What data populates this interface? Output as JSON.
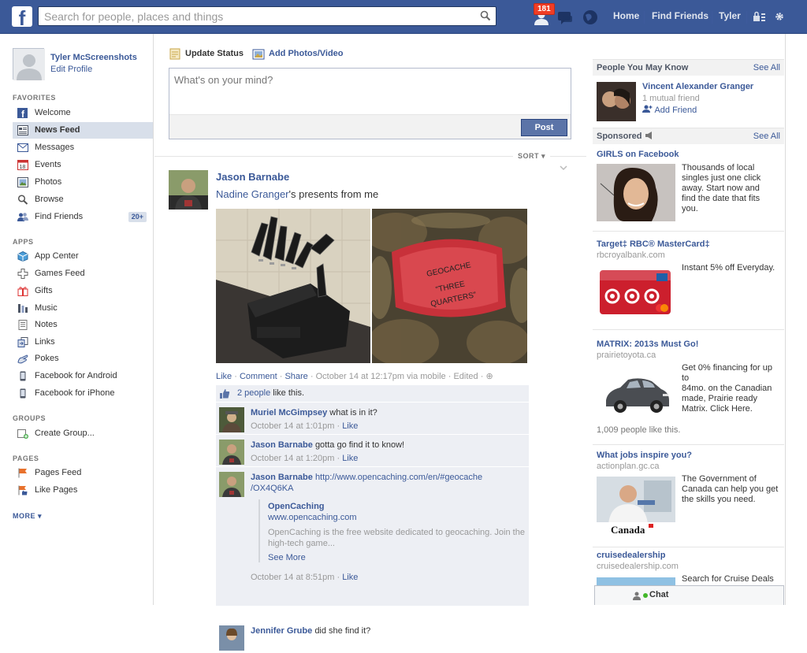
{
  "topbar": {
    "logo_letter": "f",
    "search_placeholder": "Search for people, places and things",
    "notification_count": "181",
    "nav": [
      "Home",
      "Find Friends",
      "Tyler"
    ]
  },
  "profile": {
    "name": "Tyler McScreenshots",
    "edit": "Edit Profile"
  },
  "sidebar": {
    "favorites_header": "FAVORITES",
    "favorites": [
      {
        "label": "Welcome",
        "icon": "facebook-icon"
      },
      {
        "label": "News Feed",
        "icon": "news-feed-icon",
        "selected": true
      },
      {
        "label": "Messages",
        "icon": "messages-icon"
      },
      {
        "label": "Events",
        "icon": "calendar-icon",
        "date": "18"
      },
      {
        "label": "Photos",
        "icon": "photos-icon"
      },
      {
        "label": "Browse",
        "icon": "search-icon"
      },
      {
        "label": "Find Friends",
        "icon": "friends-icon",
        "count": "20+"
      }
    ],
    "apps_header": "APPS",
    "apps": [
      {
        "label": "App Center",
        "icon": "app-center-icon"
      },
      {
        "label": "Games Feed",
        "icon": "games-icon"
      },
      {
        "label": "Gifts",
        "icon": "gift-icon"
      },
      {
        "label": "Music",
        "icon": "music-icon"
      },
      {
        "label": "Notes",
        "icon": "notes-icon"
      },
      {
        "label": "Links",
        "icon": "links-icon"
      },
      {
        "label": "Pokes",
        "icon": "poke-icon"
      },
      {
        "label": "Facebook for Android",
        "icon": "phone-icon"
      },
      {
        "label": "Facebook for iPhone",
        "icon": "phone-icon"
      }
    ],
    "groups_header": "GROUPS",
    "groups": [
      {
        "label": "Create Group...",
        "icon": "create-group-icon"
      }
    ],
    "pages_header": "PAGES",
    "pages": [
      {
        "label": "Pages Feed",
        "icon": "pages-feed-icon"
      },
      {
        "label": "Like Pages",
        "icon": "like-pages-icon"
      }
    ],
    "more": "MORE"
  },
  "composer": {
    "tab_status": "Update Status",
    "tab_photo": "Add Photos/Video",
    "placeholder": "What's on your mind?",
    "post": "Post"
  },
  "sort_label": "SORT",
  "story": {
    "author": "Jason Barnabe",
    "tagged": "Nadine Granger",
    "text_suffix": "'s presents from me",
    "photo1_label": "knife block",
    "photo2_text": "GEOCACHE \"THREE QUARTERS\"",
    "actions": [
      "Like",
      "Comment",
      "Share"
    ],
    "timestamp": "October 14 at 12:17pm via mobile",
    "edited": "Edited",
    "likes_count": "2 people",
    "likes_suffix": " like this.",
    "comments": [
      {
        "author": "Muriel McGimpsey",
        "text": "what is in it?",
        "time": "October 14 at 1:01pm",
        "like": "Like"
      },
      {
        "author": "Jason Barnabe",
        "text": "gotta go find it to know!",
        "time": "October 14 at 1:20pm",
        "like": "Like"
      },
      {
        "author": "Jason Barnabe",
        "link_line1": "http://www.opencaching.com/en/#geocache",
        "link_line2": "/OX4Q6KA",
        "preview_title": "OpenCaching",
        "preview_url": "www.opencaching.com",
        "preview_desc1": "OpenCaching is the free website dedicated to geocaching. Join the",
        "preview_desc2": "high-tech game...",
        "see_more": "See More",
        "time": "October 14 at 8:51pm",
        "like": "Like"
      },
      {
        "author": "Jennifer Grube",
        "text": "did she find it?"
      }
    ]
  },
  "right": {
    "pymk_header": "People You May Know",
    "see_all": "See All",
    "pymk": {
      "name": "Vincent Alexander Granger",
      "mutual": "1 mutual friend",
      "add": "Add Friend"
    },
    "sponsored_header": "Sponsored",
    "ads": [
      {
        "title": "GIRLS on Facebook",
        "url": "",
        "text": [
          "Thousands of local",
          "singles just one click",
          "away. Start now and",
          "find the date that fits",
          "you."
        ]
      },
      {
        "title": "Target‡ RBC® MasterCard‡",
        "url": "rbcroyalbank.com",
        "text": [
          "Instant 5% off Everyday."
        ]
      },
      {
        "title": "MATRIX: 2013s Must Go!",
        "url": "prairietoyota.ca",
        "text": [
          "Get 0% financing for up to",
          "84mo. on the Canadian",
          "made, Prairie ready",
          "Matrix. Click Here."
        ],
        "social": "1,009 people like this."
      },
      {
        "title": "What jobs inspire you?",
        "url": "actionplan.gc.ca",
        "text": [
          "The Government of",
          "Canada can help you get",
          "the skills you need."
        ],
        "brand": "Canada"
      },
      {
        "title": "cruisedealership",
        "url": "cruisedealership.com",
        "text": [
          "Search for Cruise Deals"
        ]
      }
    ]
  },
  "chat": {
    "label": "Chat"
  },
  "colors": {
    "brand": "#3b5998",
    "link": "#3b5998",
    "badge": "#f03d25"
  }
}
